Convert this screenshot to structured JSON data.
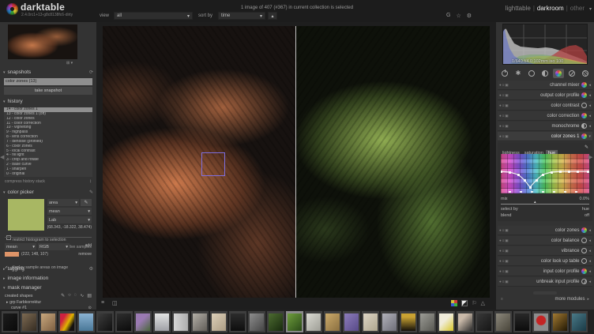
{
  "icons": {
    "caret_down": "▾",
    "caret_up": "▴",
    "caret_right": "▸",
    "caret_left": "◂",
    "collapse_left": "◀",
    "collapse_right": "▶",
    "gear": "⚙",
    "rotate": "⟳",
    "picker": "✎",
    "compress": "↕",
    "menu": "≡",
    "overlay": "◫",
    "grid_toggle": "⊞",
    "grouping": "G",
    "star": "☆",
    "prefs": "⚙",
    "pencil": "✎",
    "shape_circle": "○",
    "shape_ellipse": "◌",
    "shape_path": "∿",
    "shape_gradient": "▤",
    "shape_indicator": "⊙",
    "favorites": "✱",
    "module_controls": "●≡▣",
    "flag": "⚐",
    "gamut": "△",
    "check": "✓"
  },
  "titlebar": {
    "app_name": "darktable",
    "version": "2.4.0rc1+13-g8c8138fc6-dirty",
    "status": "1 image of 407 (#367) in current collection is selected",
    "views": {
      "lighttable": "lighttable",
      "darkroom": "darkroom",
      "other": "other"
    }
  },
  "viewbar": {
    "view_label": "view",
    "view_value": "all",
    "sort_label": "sort by",
    "sort_value": "time"
  },
  "left": {
    "snapshots": {
      "title": "snapshots",
      "item": "color zones (13)",
      "button": "take snapshot"
    },
    "history": {
      "title": "history",
      "items": [
        "14 - color zones 1",
        "13 - color zones 1 (off)",
        "12 - color zones",
        "11 - color correction",
        "10 - vignetting",
        "9 - highpass",
        "8 - lens correction",
        "7 - denoise (profiled)",
        "6 - color zones",
        "5 - local contrast",
        "4 - fill light",
        "3 - crop and rotate",
        "2 - base curve",
        "1 - sharpen",
        "0 - original"
      ],
      "compress": "compress history stack"
    },
    "picker": {
      "title": "color picker",
      "mode": "area",
      "stat": "mean",
      "space": "Lab",
      "values": "(68.343, -18.322, 38.474)",
      "restrict": "restrict histogram to selection",
      "live": "live samples",
      "sample_stat": "mean",
      "sample_space": "RGB",
      "add": "add",
      "sample_values": "(222, 148, 107)",
      "remove": "remove",
      "display": "display sample areas on image",
      "swatch_color": "#a8b763",
      "sample_color": "#de9468"
    },
    "tagging": "tagging",
    "info": "image information",
    "mask": {
      "title": "mask manager",
      "created": "created shapes",
      "group": "grp Farbkorrektur",
      "item": "curve #1"
    }
  },
  "right": {
    "exif": "1/640 f/4.0 102mm iso 100",
    "groups": [
      "active",
      "favorites",
      "basic",
      "tone",
      "color",
      "correction",
      "effect"
    ],
    "modules_top": [
      "channel mixer",
      "output color profile",
      "color contrast",
      "color correction",
      "monochrome",
      "color zones 1"
    ],
    "cz": {
      "tabs": [
        "lightness",
        "saturation",
        "hue"
      ],
      "active_tab": "hue",
      "mix_label": "mix",
      "mix_value": "0.0%",
      "select_by_label": "select by",
      "select_by_value": "hue",
      "blend_label": "blend",
      "blend_value": "off"
    },
    "modules_bottom": [
      "color zones",
      "color balance",
      "vibrance",
      "color look up table",
      "input color profile",
      "unbreak input profile"
    ],
    "more": "more modules"
  },
  "filmstrip": {
    "thumbs": [
      {
        "style": "background:linear-gradient(135deg,#1c1c1c,#0a0a0a)"
      },
      {
        "style": "background:linear-gradient(135deg,#7d6a52,#352c22)"
      },
      {
        "style": "background:linear-gradient(135deg,#c9a87e,#7d5f41)"
      },
      {
        "style": "background:linear-gradient(120deg,#cf2040 25%,#e0b400 55%,#151210 80%)"
      },
      {
        "style": "background:linear-gradient(180deg,#8ab2d2,#4a7898)"
      },
      {
        "style": "background:linear-gradient(135deg,#3c3c3c,#101010)"
      },
      {
        "style": "background:linear-gradient(160deg,#2e2e2e,#0b0b0b)"
      },
      {
        "style": "background:linear-gradient(135deg,#9a7ab2 40%,#49663a)"
      },
      {
        "style": "background:linear-gradient(180deg,#e2e2e2,#9fa0a6)"
      },
      {
        "style": "background:linear-gradient(90deg,#d6d6d6,#aeaeae)"
      },
      {
        "style": "background:linear-gradient(135deg,#b3afa7,#625e58)"
      },
      {
        "style": "background:linear-gradient(135deg,#dccfb8,#ab9c84)"
      },
      {
        "style": "background:linear-gradient(180deg,#2c2c2c,#0e0e0e)"
      },
      {
        "style": "background:linear-gradient(135deg,#8e8e8e,#464646)"
      },
      {
        "style": "background:linear-gradient(135deg,#4d6c31,#182a0e)"
      },
      {
        "style": "background:linear-gradient(135deg,#6f9e3c,#2a4a18)"
      },
      {
        "style": "background:linear-gradient(135deg,#dadad2,#9e9e96)"
      },
      {
        "style": "background:linear-gradient(135deg,#cbaa6a,#8a6f40)"
      },
      {
        "style": "background:linear-gradient(135deg,#8c7cba,#584a88)"
      },
      {
        "style": "background:linear-gradient(135deg,#dcd4c4,#aea68e)"
      },
      {
        "style": "background:linear-gradient(135deg,#b2b2ba,#6e6e78)"
      },
      {
        "style": "background:linear-gradient(180deg,#c9a232 20%,#14100a)"
      },
      {
        "style": "background:linear-gradient(135deg,#9c9c96,#585852)"
      },
      {
        "style": "background:linear-gradient(135deg,#f0ecda 40%,#d8c626)"
      },
      {
        "style": "background:linear-gradient(135deg,#c9b9a9 30%,#2c2c2c)"
      },
      {
        "style": "background:linear-gradient(135deg,#383838,#161616)"
      },
      {
        "style": "background:linear-gradient(135deg,#8c887c,#49453a)"
      },
      {
        "style": "background:linear-gradient(180deg,#282828,#0c0c0c)"
      },
      {
        "style": "background:radial-gradient(circle at 50% 40%,#c42424 35%,#8c8c8c 42%)"
      },
      {
        "style": "background:linear-gradient(135deg,#a27a32,#221804)"
      },
      {
        "style": "background:linear-gradient(135deg,#4a7a88,#1a3a46)"
      }
    ]
  }
}
